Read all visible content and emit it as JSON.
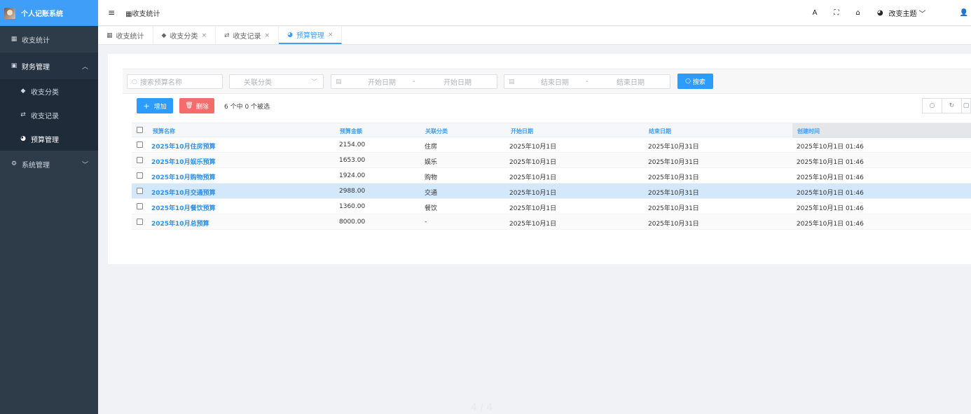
{
  "sidebar": {
    "brand": "个人记账系统",
    "items": [
      {
        "label": "收支统计",
        "icon": "grid-icon"
      },
      {
        "label": "财务管理",
        "icon": "wallet-icon"
      },
      {
        "label": "收支分类",
        "icon": "tag-icon"
      },
      {
        "label": "收支记录",
        "icon": "exchange-icon"
      },
      {
        "label": "预算管理",
        "icon": "pie-icon"
      },
      {
        "label": "系统管理",
        "icon": "gears-icon"
      }
    ]
  },
  "header": {
    "breadcrumb": "收支统计",
    "theme_label": "改变主题",
    "font_icon_label": "A"
  },
  "tabs": [
    {
      "label": "收支统计"
    },
    {
      "label": "收支分类"
    },
    {
      "label": "收支记录"
    },
    {
      "label": "预算管理"
    }
  ],
  "search": {
    "name_placeholder": "搜索预算名称",
    "category_placeholder": "关联分类",
    "start_from": "开始日期",
    "start_to": "开始日期",
    "end_from": "结束日期",
    "end_to": "结束日期",
    "range_sep": "-",
    "button": "搜索"
  },
  "toolbar": {
    "add": "增加",
    "delete": "删除",
    "selection_info": "6 个中 0 个被选"
  },
  "table": {
    "columns": [
      "预算名称",
      "预算金额",
      "关联分类",
      "开始日期",
      "结束日期",
      "创建时间"
    ],
    "rows": [
      {
        "name": "2025年10月住房预算",
        "amount": "2154.00",
        "category": "住房",
        "start": "2025年10月1日",
        "end": "2025年10月31日",
        "created": "2025年10月1日 01:46"
      },
      {
        "name": "2025年10月娱乐预算",
        "amount": "1653.00",
        "category": "娱乐",
        "start": "2025年10月1日",
        "end": "2025年10月31日",
        "created": "2025年10月1日 01:46"
      },
      {
        "name": "2025年10月购物预算",
        "amount": "1924.00",
        "category": "购物",
        "start": "2025年10月1日",
        "end": "2025年10月31日",
        "created": "2025年10月1日 01:46"
      },
      {
        "name": "2025年10月交通预算",
        "amount": "2988.00",
        "category": "交通",
        "start": "2025年10月1日",
        "end": "2025年10月31日",
        "created": "2025年10月1日 01:46"
      },
      {
        "name": "2025年10月餐饮预算",
        "amount": "1360.00",
        "category": "餐饮",
        "start": "2025年10月1日",
        "end": "2025年10月31日",
        "created": "2025年10月1日 01:46"
      },
      {
        "name": "2025年10月总预算",
        "amount": "8000.00",
        "category": "-",
        "start": "2025年10月1日",
        "end": "2025年10月31日",
        "created": "2025年10月1日 01:46"
      }
    ]
  },
  "pager": "4 / 4",
  "colors": {
    "primary": "#2d9cff",
    "danger": "#f56c6c",
    "sidebar": "#2e3c4a",
    "selected_row": "#d3e8fb"
  }
}
